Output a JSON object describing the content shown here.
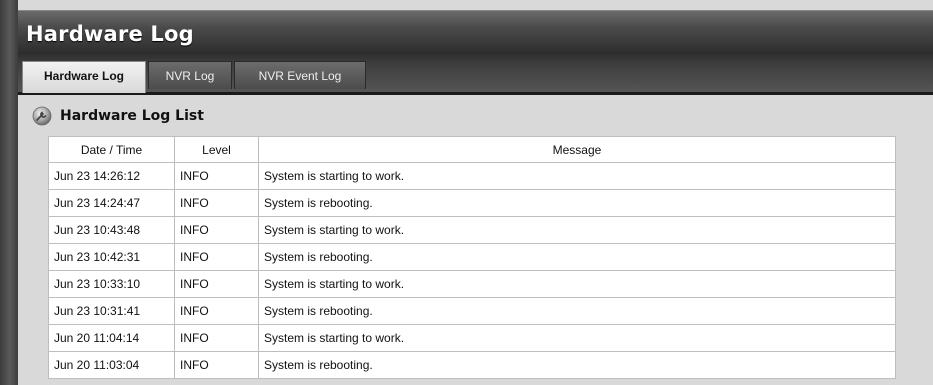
{
  "window": {
    "title": "Hardware Log"
  },
  "tabs": [
    {
      "label": "Hardware Log",
      "active": true
    },
    {
      "label": "NVR Log",
      "active": false
    },
    {
      "label": "NVR Event Log",
      "active": false
    }
  ],
  "section": {
    "title": "Hardware Log List",
    "icon": "wrench-disc-icon"
  },
  "table": {
    "headers": {
      "date": "Date / Time",
      "level": "Level",
      "message": "Message"
    },
    "rows": [
      {
        "date": "Jun 23 14:26:12",
        "level": "INFO",
        "message": "System is starting to work."
      },
      {
        "date": "Jun 23 14:24:47",
        "level": "INFO",
        "message": "System is rebooting."
      },
      {
        "date": "Jun 23 10:43:48",
        "level": "INFO",
        "message": "System is starting to work."
      },
      {
        "date": "Jun 23 10:42:31",
        "level": "INFO",
        "message": "System is rebooting."
      },
      {
        "date": "Jun 23 10:33:10",
        "level": "INFO",
        "message": "System is starting to work."
      },
      {
        "date": "Jun 23 10:31:41",
        "level": "INFO",
        "message": "System is rebooting."
      },
      {
        "date": "Jun 20 11:04:14",
        "level": "INFO",
        "message": "System is starting to work."
      },
      {
        "date": "Jun 20 11:03:04",
        "level": "INFO",
        "message": "System is rebooting."
      }
    ]
  }
}
